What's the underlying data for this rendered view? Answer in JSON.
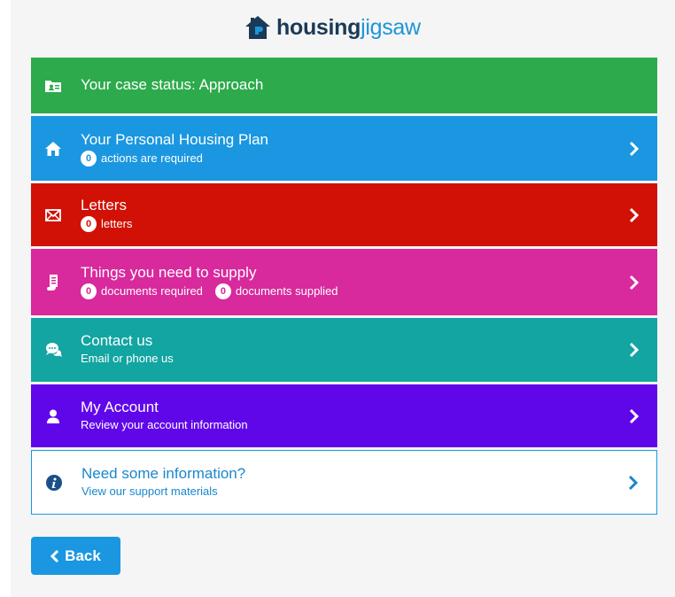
{
  "logo": {
    "bold": "housing",
    "light": "jigsaw"
  },
  "case_status": {
    "label": "Your case status: Approach"
  },
  "plan": {
    "title": "Your Personal Housing Plan",
    "count": "0",
    "suffix": "actions are required"
  },
  "letters": {
    "title": "Letters",
    "count": "0",
    "suffix": "letters"
  },
  "supply": {
    "title": "Things you need to supply",
    "required_count": "0",
    "required_suffix": "documents required",
    "supplied_count": "0",
    "supplied_suffix": "documents supplied"
  },
  "contact": {
    "title": "Contact us",
    "sub": "Email or phone us"
  },
  "account": {
    "title": "My Account",
    "sub": "Review your account information"
  },
  "info": {
    "title": "Need some information?",
    "sub": "View our support materials"
  },
  "back": {
    "label": "Back"
  },
  "icons": {
    "case": "folder-id-icon",
    "plan": "home-icon",
    "letters": "envelope-icon",
    "supply": "document-scroll-icon",
    "contact": "chat-bubbles-icon",
    "account": "user-icon",
    "info": "info-icon",
    "chevron": "chevron-right-icon"
  },
  "colors": {
    "green": "#2daa4c",
    "blue": "#1a97e0",
    "red": "#d11105",
    "pink": "#d8299d",
    "teal": "#12a5a2",
    "purple": "#6007ea",
    "navy": "#1b3a57"
  }
}
